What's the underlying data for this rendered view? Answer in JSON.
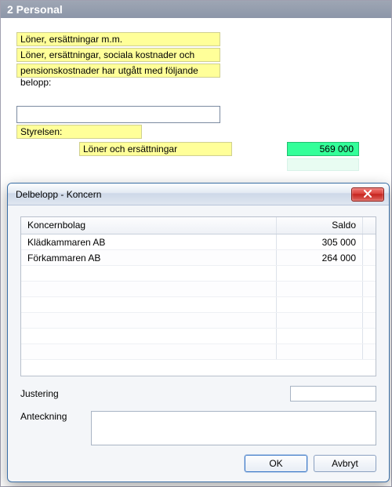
{
  "window": {
    "title": "2 Personal"
  },
  "section": {
    "line1": "Löner, ersättningar m.m.",
    "line2": "Löner, ersättningar, sociala kostnader och",
    "line3": "pensionskostnader har utgått med följande belopp:",
    "styrelsen_label": "Styrelsen:",
    "salaries_label": "Löner och ersättningar",
    "salaries_value": "569 000"
  },
  "dialog": {
    "title": "Delbelopp - Koncern",
    "columns": {
      "name": "Koncernbolag",
      "saldo": "Saldo"
    },
    "rows": [
      {
        "name": "Klädkammaren AB",
        "saldo": "305 000"
      },
      {
        "name": "Förkammaren AB",
        "saldo": "264 000"
      }
    ],
    "adjust_label": "Justering",
    "note_label": "Anteckning",
    "ok_label": "OK",
    "cancel_label": "Avbryt",
    "adjust_value": "",
    "note_value": ""
  },
  "colors": {
    "highlight_yellow": "#ffff99",
    "value_green": "#33ff99"
  }
}
